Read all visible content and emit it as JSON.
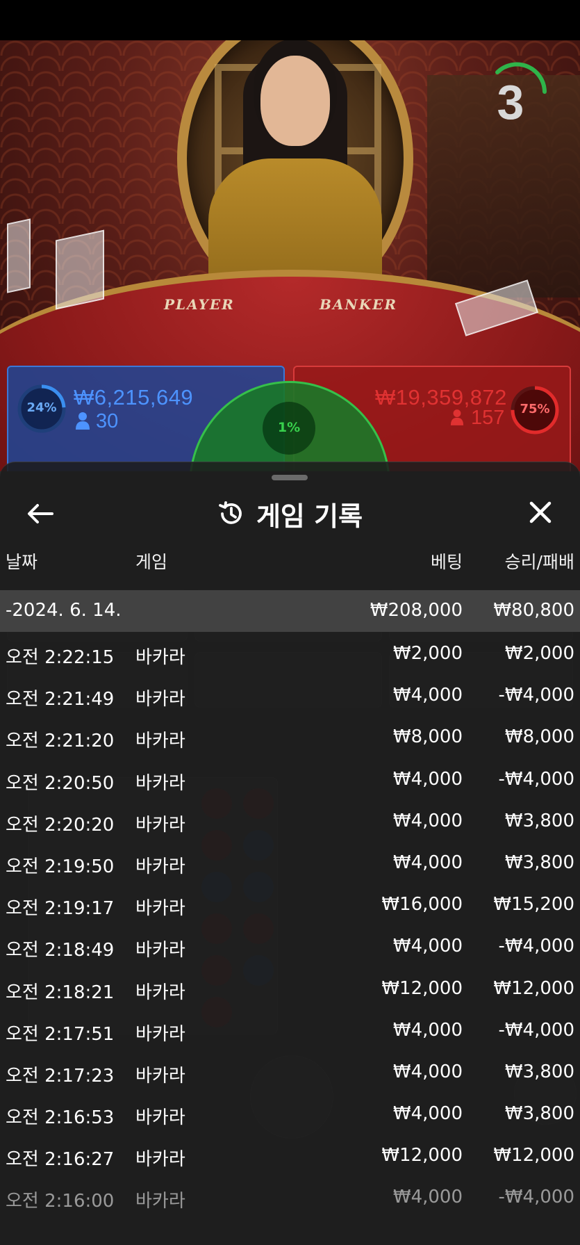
{
  "video": {
    "table_player_label": "PLAYER",
    "table_banker_label": "BANKER",
    "countdown": "3"
  },
  "bets": {
    "player": {
      "percent": "24%",
      "percent_value": 24,
      "amount": "₩6,215,649",
      "players": "30"
    },
    "tie": {
      "percent": "1%",
      "percent_value": 1
    },
    "banker": {
      "percent": "75%",
      "percent_value": 75,
      "amount": "₩19,359,872",
      "players": "157"
    }
  },
  "colors": {
    "player": "#3b78d8",
    "banker": "#d83b3b",
    "tie": "#36c04a"
  },
  "history": {
    "title": "게임 기록",
    "title_icon": "history-icon",
    "back_icon": "arrow-left-icon",
    "close_icon": "close-icon",
    "columns": {
      "date": "날짜",
      "game": "게임",
      "bet": "베팅",
      "result": "승리/패배"
    },
    "day": {
      "date": "-2024. 6. 14.",
      "bet": "₩208,000",
      "result": "₩80,800"
    },
    "rows": [
      {
        "time": "오전 2:22:15",
        "game": "바카라",
        "bet": "₩2,000",
        "result": "₩2,000"
      },
      {
        "time": "오전 2:21:49",
        "game": "바카라",
        "bet": "₩4,000",
        "result": "-₩4,000"
      },
      {
        "time": "오전 2:21:20",
        "game": "바카라",
        "bet": "₩8,000",
        "result": "₩8,000"
      },
      {
        "time": "오전 2:20:50",
        "game": "바카라",
        "bet": "₩4,000",
        "result": "-₩4,000"
      },
      {
        "time": "오전 2:20:20",
        "game": "바카라",
        "bet": "₩4,000",
        "result": "₩3,800"
      },
      {
        "time": "오전 2:19:50",
        "game": "바카라",
        "bet": "₩4,000",
        "result": "₩3,800"
      },
      {
        "time": "오전 2:19:17",
        "game": "바카라",
        "bet": "₩16,000",
        "result": "₩15,200"
      },
      {
        "time": "오전 2:18:49",
        "game": "바카라",
        "bet": "₩4,000",
        "result": "-₩4,000"
      },
      {
        "time": "오전 2:18:21",
        "game": "바카라",
        "bet": "₩12,000",
        "result": "₩12,000"
      },
      {
        "time": "오전 2:17:51",
        "game": "바카라",
        "bet": "₩4,000",
        "result": "-₩4,000"
      },
      {
        "time": "오전 2:17:23",
        "game": "바카라",
        "bet": "₩4,000",
        "result": "₩3,800"
      },
      {
        "time": "오전 2:16:53",
        "game": "바카라",
        "bet": "₩4,000",
        "result": "₩3,800"
      },
      {
        "time": "오전 2:16:27",
        "game": "바카라",
        "bet": "₩12,000",
        "result": "₩12,000"
      },
      {
        "time": "오전 2:16:00",
        "game": "바카라",
        "bet": "₩4,000",
        "result": "-₩4,000"
      }
    ]
  }
}
